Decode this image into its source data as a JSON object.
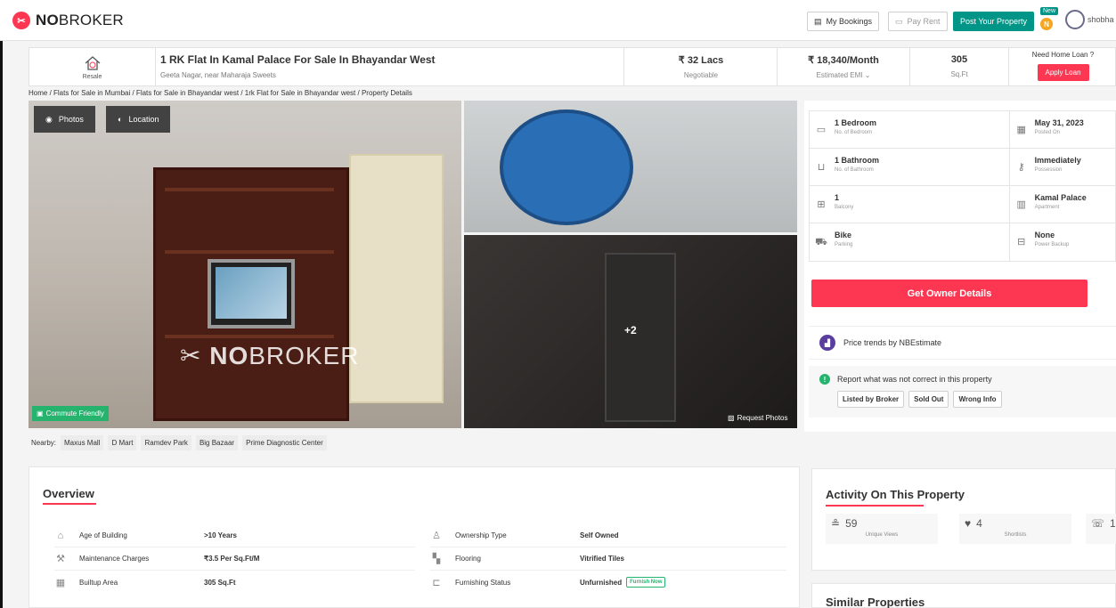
{
  "nav": {
    "logo_text_bold": "NO",
    "logo_text_rest": "BROKER",
    "my_bookings": "My Bookings",
    "pay_rent": "Pay Rent",
    "post_property": "Post Your Property",
    "new_badge": "New",
    "coin_letter": "N",
    "user_name": "shobha k"
  },
  "header": {
    "resale_label": "Resale",
    "title": "1 RK Flat In Kamal Palace For Sale In Bhayandar West",
    "subtitle": "Geeta Nagar, near Maharaja Sweets",
    "price": "₹ 32 Lacs",
    "price_label": "Negotiable",
    "emi": "₹ 18,340/Month",
    "emi_label": "Estimated EMI ⌄",
    "area": "305",
    "area_label": "Sq.Ft",
    "loan_question": "Need Home Loan ?",
    "loan_button": "Apply Loan"
  },
  "breadcrumb": "Home / Flats for Sale in Mumbai / Flats for Sale in Bhayandar west / 1rk Flat for Sale in Bhayandar west / Property Details",
  "photos": {
    "tab_photos": "Photos",
    "tab_location": "Location",
    "watermark": "NOBROKER",
    "commute": "Commute Friendly",
    "more_count": "+2",
    "request_photos": "Request Photos"
  },
  "nearby": {
    "label": "Nearby:",
    "places": [
      "Maxus Mall",
      "D Mart",
      "Ramdev Park",
      "Big Bazaar",
      "Prime Diagnostic Center"
    ]
  },
  "details": [
    {
      "value": "1 Bedroom",
      "label": "No. of Bedroom",
      "icon": "bed-icon"
    },
    {
      "value": "May 31, 2023",
      "label": "Posted On",
      "icon": "calendar-icon"
    },
    {
      "value": "1 Bathroom",
      "label": "No. of Bathroom",
      "icon": "bathtub-icon"
    },
    {
      "value": "Immediately",
      "label": "Possession",
      "icon": "key-icon"
    },
    {
      "value": "1",
      "label": "Balcony",
      "icon": "balcony-icon"
    },
    {
      "value": "Kamal Palace",
      "label": "Apartment",
      "icon": "building-icon"
    },
    {
      "value": "Bike",
      "label": "Parking",
      "icon": "car-icon"
    },
    {
      "value": "None",
      "label": "Power Backup",
      "icon": "battery-icon"
    }
  ],
  "owner_button": "Get Owner Details",
  "trends_text": "Price trends by NBEstimate",
  "report": {
    "text": "Report what was not correct in this property",
    "buttons": [
      "Listed by Broker",
      "Sold Out",
      "Wrong Info"
    ]
  },
  "overview": {
    "title": "Overview",
    "rows_left": [
      {
        "label": "Age of Building",
        "value": ">10 Years",
        "icon": "building-age-icon"
      },
      {
        "label": "Maintenance Charges",
        "value": "₹3.5 Per Sq.Ft/M",
        "icon": "maintenance-icon"
      },
      {
        "label": "Builtup Area",
        "value": "305 Sq.Ft",
        "icon": "area-icon"
      }
    ],
    "rows_right": [
      {
        "label": "Ownership Type",
        "value": "Self Owned",
        "icon": "ownership-icon"
      },
      {
        "label": "Flooring",
        "value": "Vitrified Tiles",
        "icon": "flooring-icon"
      },
      {
        "label": "Furnishing Status",
        "value": "Unfurnished",
        "icon": "sofa-icon"
      }
    ],
    "furnish_now": "Furnish Now"
  },
  "activity": {
    "title": "Activity On This Property",
    "views": "59",
    "views_label": "Unique Views",
    "shortlists": "4",
    "shortlists_label": "Shortlists",
    "contacts": "1"
  },
  "similar_title": "Similar Properties",
  "colors": {
    "brand": "#fd3752",
    "teal": "#009587",
    "green": "#25b36e"
  }
}
